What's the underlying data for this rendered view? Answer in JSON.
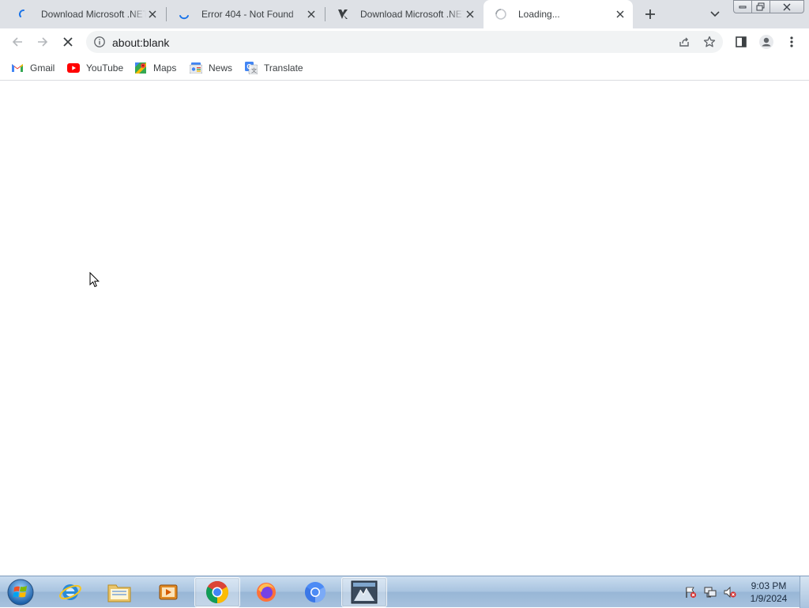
{
  "tabs": [
    {
      "title": "Download Microsoft .NET",
      "favicon": "loading-spinner-icon",
      "active": false
    },
    {
      "title": "Error 404 - Not Found",
      "favicon": "loading-spinner-icon",
      "active": false
    },
    {
      "title": "Download Microsoft .NET",
      "favicon": "site-logo-icon",
      "active": false
    },
    {
      "title": "Loading...",
      "favicon": "loading-spinner-icon",
      "active": true
    }
  ],
  "toolbar": {
    "url": "about:blank"
  },
  "bookmarks": [
    {
      "label": "Gmail",
      "icon": "gmail-icon"
    },
    {
      "label": "YouTube",
      "icon": "youtube-icon"
    },
    {
      "label": "Maps",
      "icon": "maps-icon"
    },
    {
      "label": "News",
      "icon": "news-icon"
    },
    {
      "label": "Translate",
      "icon": "translate-icon"
    }
  ],
  "taskbar": {
    "apps": [
      "internet-explorer",
      "windows-explorer",
      "media-player",
      "chrome",
      "firefox",
      "chromium",
      "app-window"
    ],
    "clock_time": "9:03 PM",
    "clock_date": "1/9/2024"
  },
  "colors": {
    "tabstrip_bg": "#dee1e6",
    "accent_blue": "#1a73e8",
    "youtube_red": "#ff0000"
  }
}
